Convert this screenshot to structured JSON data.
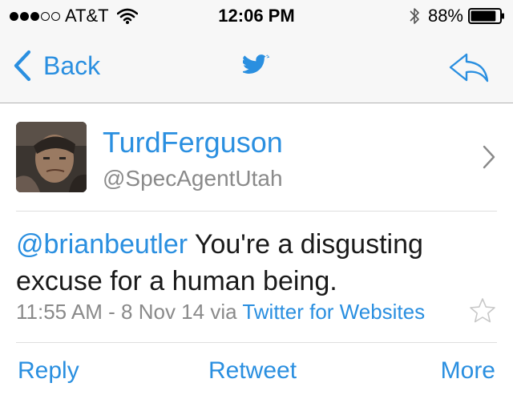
{
  "status_bar": {
    "signal_dots": {
      "filled": 3,
      "empty": 2
    },
    "carrier": "AT&T",
    "time": "12:06 PM",
    "battery": "88%",
    "battery_level": 0.88
  },
  "nav": {
    "back_label": "Back",
    "center_icon": "twitter-bird-icon",
    "right_icon": "reply-arrow-icon"
  },
  "profile": {
    "display_name": "TurdFerguson",
    "username": "@SpecAgentUtah"
  },
  "tweet": {
    "mention": "@brianbeutler",
    "text": " You're a disgusting excuse for a human being.",
    "time_date": "11:55 AM - 8 Nov 14",
    "via": " via ",
    "source": "Twitter for Websites"
  },
  "actions": {
    "reply": "Reply",
    "retweet": "Retweet",
    "more": "More"
  },
  "colors": {
    "accent": "#2a8fe0",
    "secondary_text": "#8a8a8a",
    "bar_background": "#f7f7f7"
  }
}
